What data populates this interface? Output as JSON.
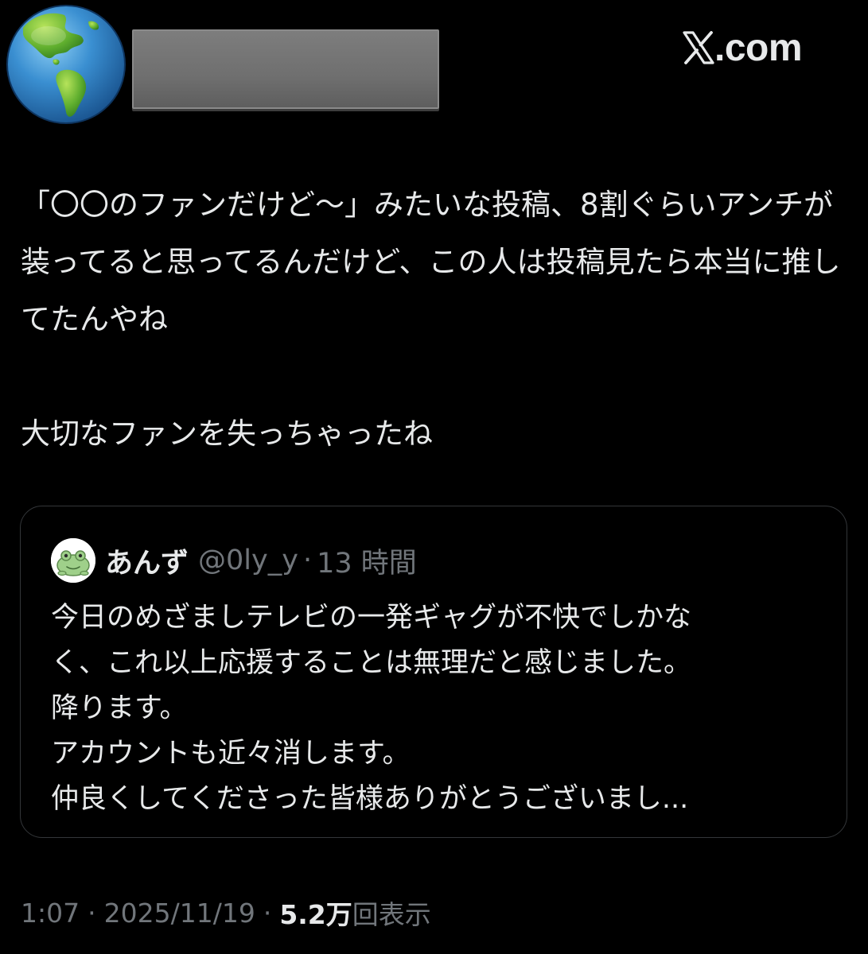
{
  "author": {
    "avatar_icon": "globe-americas-icon",
    "name_redacted": true
  },
  "watermark": {
    "text": ".com",
    "logo_icon": "x-logo-icon"
  },
  "post": {
    "paragraphs": [
      "「〇〇のファンだけど〜」みたいな投稿、8割ぐらいアンチが装ってると思ってるんだけど、この人は投稿見たら本当に推してたんやね",
      "大切なファンを失っちゃったね"
    ]
  },
  "quote": {
    "avatar_icon": "frog-icon",
    "name": "あんず",
    "handle": "@0ly_y",
    "separator": "·",
    "time": "13 時間",
    "lines": [
      "今日のめざましテレビの一発ギャグが不快でしかな",
      "く、これ以上応援することは無理だと感じました。",
      "降ります。",
      "アカウントも近々消します。",
      "仲良くしてくださった皆様ありがとうございまし..."
    ]
  },
  "meta": {
    "time": "1:07",
    "date": "2025/11/19",
    "separator": "·",
    "views_count": "5.2万",
    "views_label": "回表示"
  },
  "colors": {
    "background": "#000000",
    "text_primary": "#e7e9ea",
    "text_secondary": "#71767b",
    "border": "#333639"
  }
}
